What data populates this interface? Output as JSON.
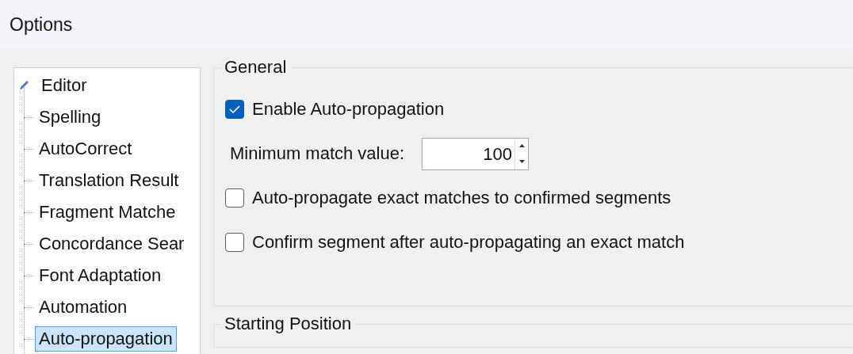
{
  "window": {
    "title": "Options"
  },
  "tree": [
    {
      "label": "Editor",
      "selected": false,
      "children": [
        {
          "label": "Spelling",
          "selected": false
        },
        {
          "label": "AutoCorrect",
          "selected": false
        },
        {
          "label": "Translation Result",
          "selected": false
        },
        {
          "label": "Fragment Matche",
          "selected": false
        },
        {
          "label": "Concordance Sear",
          "selected": false
        },
        {
          "label": "Font Adaptation",
          "selected": false
        },
        {
          "label": "Automation",
          "selected": false
        },
        {
          "label": "Auto-propagation",
          "selected": true
        }
      ]
    }
  ],
  "groups": [
    {
      "title": "General",
      "items": [
        {
          "kind": "checkbox",
          "label": "Enable Auto-propagation",
          "checked": true
        },
        {
          "kind": "spinner",
          "label": "Minimum match value:",
          "value": "100"
        },
        {
          "kind": "checkbox",
          "label": "Auto-propagate exact matches to confirmed segments",
          "checked": false
        },
        {
          "kind": "checkbox",
          "label": "Confirm segment after auto-propagating an exact match",
          "checked": false
        }
      ]
    },
    {
      "title": "Starting Position"
    }
  ]
}
